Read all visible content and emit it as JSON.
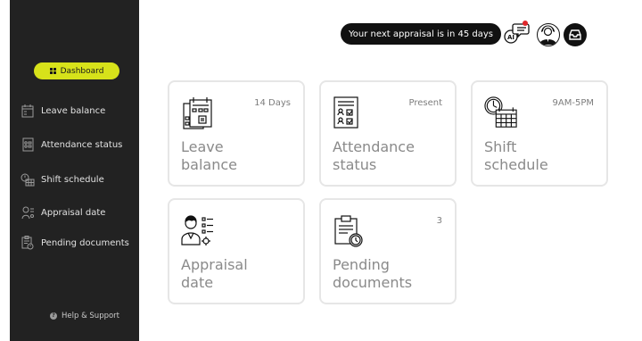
{
  "colors": {
    "sidebar": "#222222",
    "accent": "#d7e21a",
    "notification": "#e0262a",
    "card_border": "#e6e6e6"
  },
  "sidebar": {
    "dashboard_label": "Dashboard",
    "items": [
      {
        "label": "Leave balance",
        "icon": "calendar-icon"
      },
      {
        "label": "Attendance status",
        "icon": "clipboard-icon"
      },
      {
        "label": "Shift schedule",
        "icon": "clock-calendar-icon"
      },
      {
        "label": "Appraisal date",
        "icon": "person-badge-icon"
      },
      {
        "label": "Pending documents",
        "icon": "document-clock-icon"
      }
    ],
    "help_label": "Help & Support"
  },
  "header": {
    "notice": "Your next appraisal is in 45 days",
    "ai_label": "AI"
  },
  "cards": [
    {
      "title": "Leave\nbalance",
      "value": "14 Days",
      "icon": "calendar-icon"
    },
    {
      "title": "Attendance\nstatus",
      "value": "Present",
      "icon": "clipboard-icon"
    },
    {
      "title": "Shift\nschedule",
      "value": "9AM-5PM",
      "icon": "clock-calendar-icon"
    },
    {
      "title": "Appraisal\ndate",
      "value": "",
      "icon": "person-badge-icon"
    },
    {
      "title": "Pending\ndocuments",
      "value": "3",
      "icon": "document-clock-icon"
    }
  ]
}
